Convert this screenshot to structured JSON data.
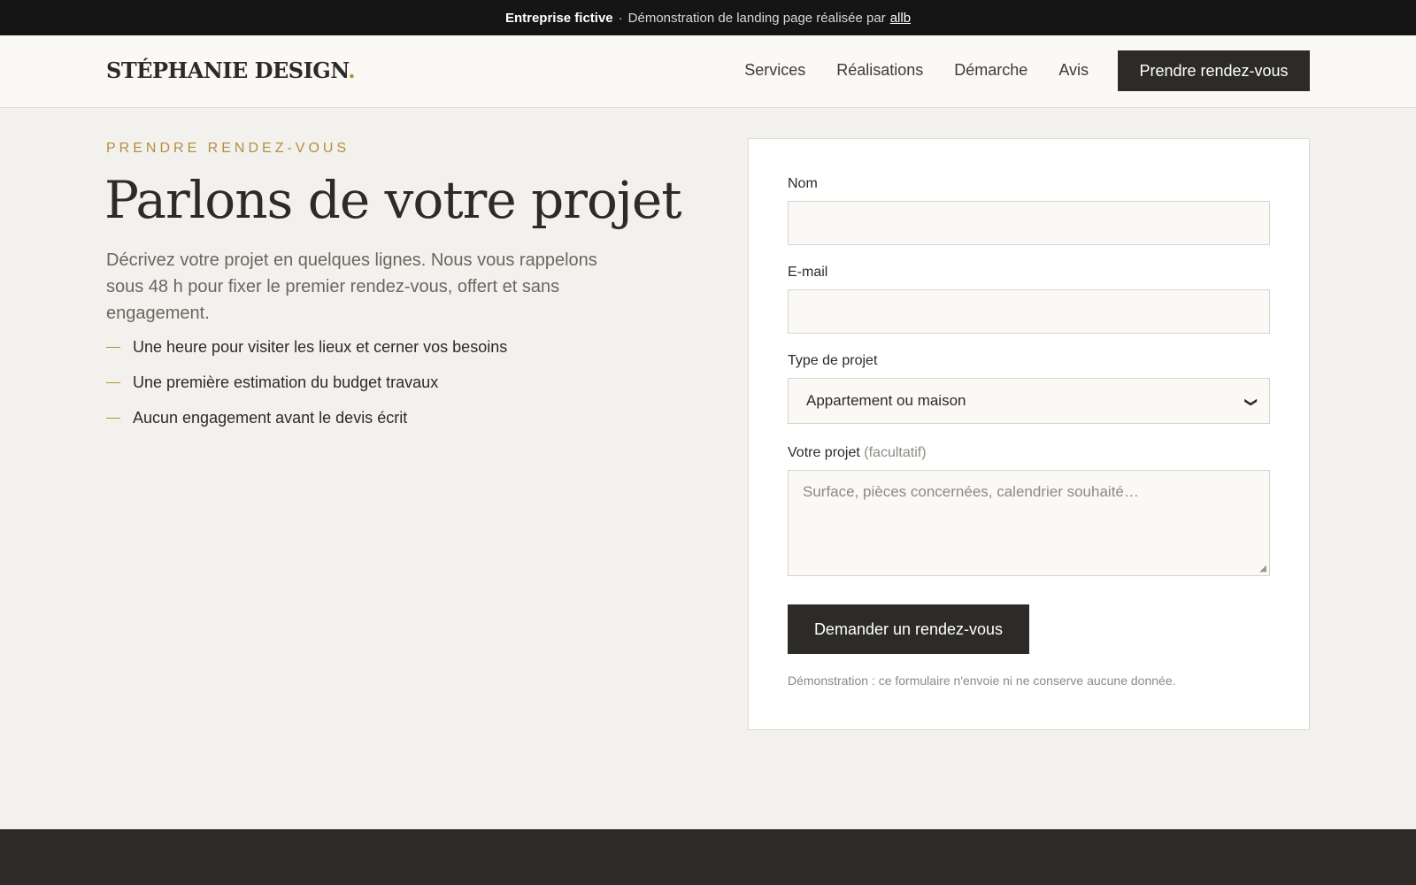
{
  "topbar": {
    "company": "Entreprise fictive",
    "separator": "·",
    "text": "Démonstration de landing page réalisée par",
    "link": "allb"
  },
  "header": {
    "logo": "STÉPHANIE DESIGN",
    "logo_dot": ".",
    "nav": [
      "Services",
      "Réalisations",
      "Démarche",
      "Avis"
    ],
    "cta": "Prendre rendez-vous"
  },
  "hero": {
    "eyebrow": "PRENDRE RENDEZ-VOUS",
    "title": "Parlons de votre projet",
    "description": "Décrivez votre projet en quelques lignes. Nous vous rappelons sous 48 h pour fixer le premier rendez-vous, offert et sans engagement.",
    "bullets": [
      "Une heure pour visiter les lieux et cerner vos besoins",
      "Une première estimation du budget travaux",
      "Aucun engagement avant le devis écrit"
    ]
  },
  "form": {
    "name_label": "Nom",
    "name_value": "",
    "email_label": "E-mail",
    "email_value": "",
    "type_label": "Type de projet",
    "type_selected": "Appartement ou maison",
    "project_label": "Votre projet",
    "project_optional": "(facultatif)",
    "project_placeholder": "Surface, pièces concernées, calendrier souhaité…",
    "submit": "Demander un rendez-vous",
    "note": "Démonstration : ce formulaire n'envoie ni ne conserve aucune donnée."
  },
  "colors": {
    "accent": "#b58e3d",
    "dark": "#2d2b27",
    "background": "#f3f1ed"
  }
}
